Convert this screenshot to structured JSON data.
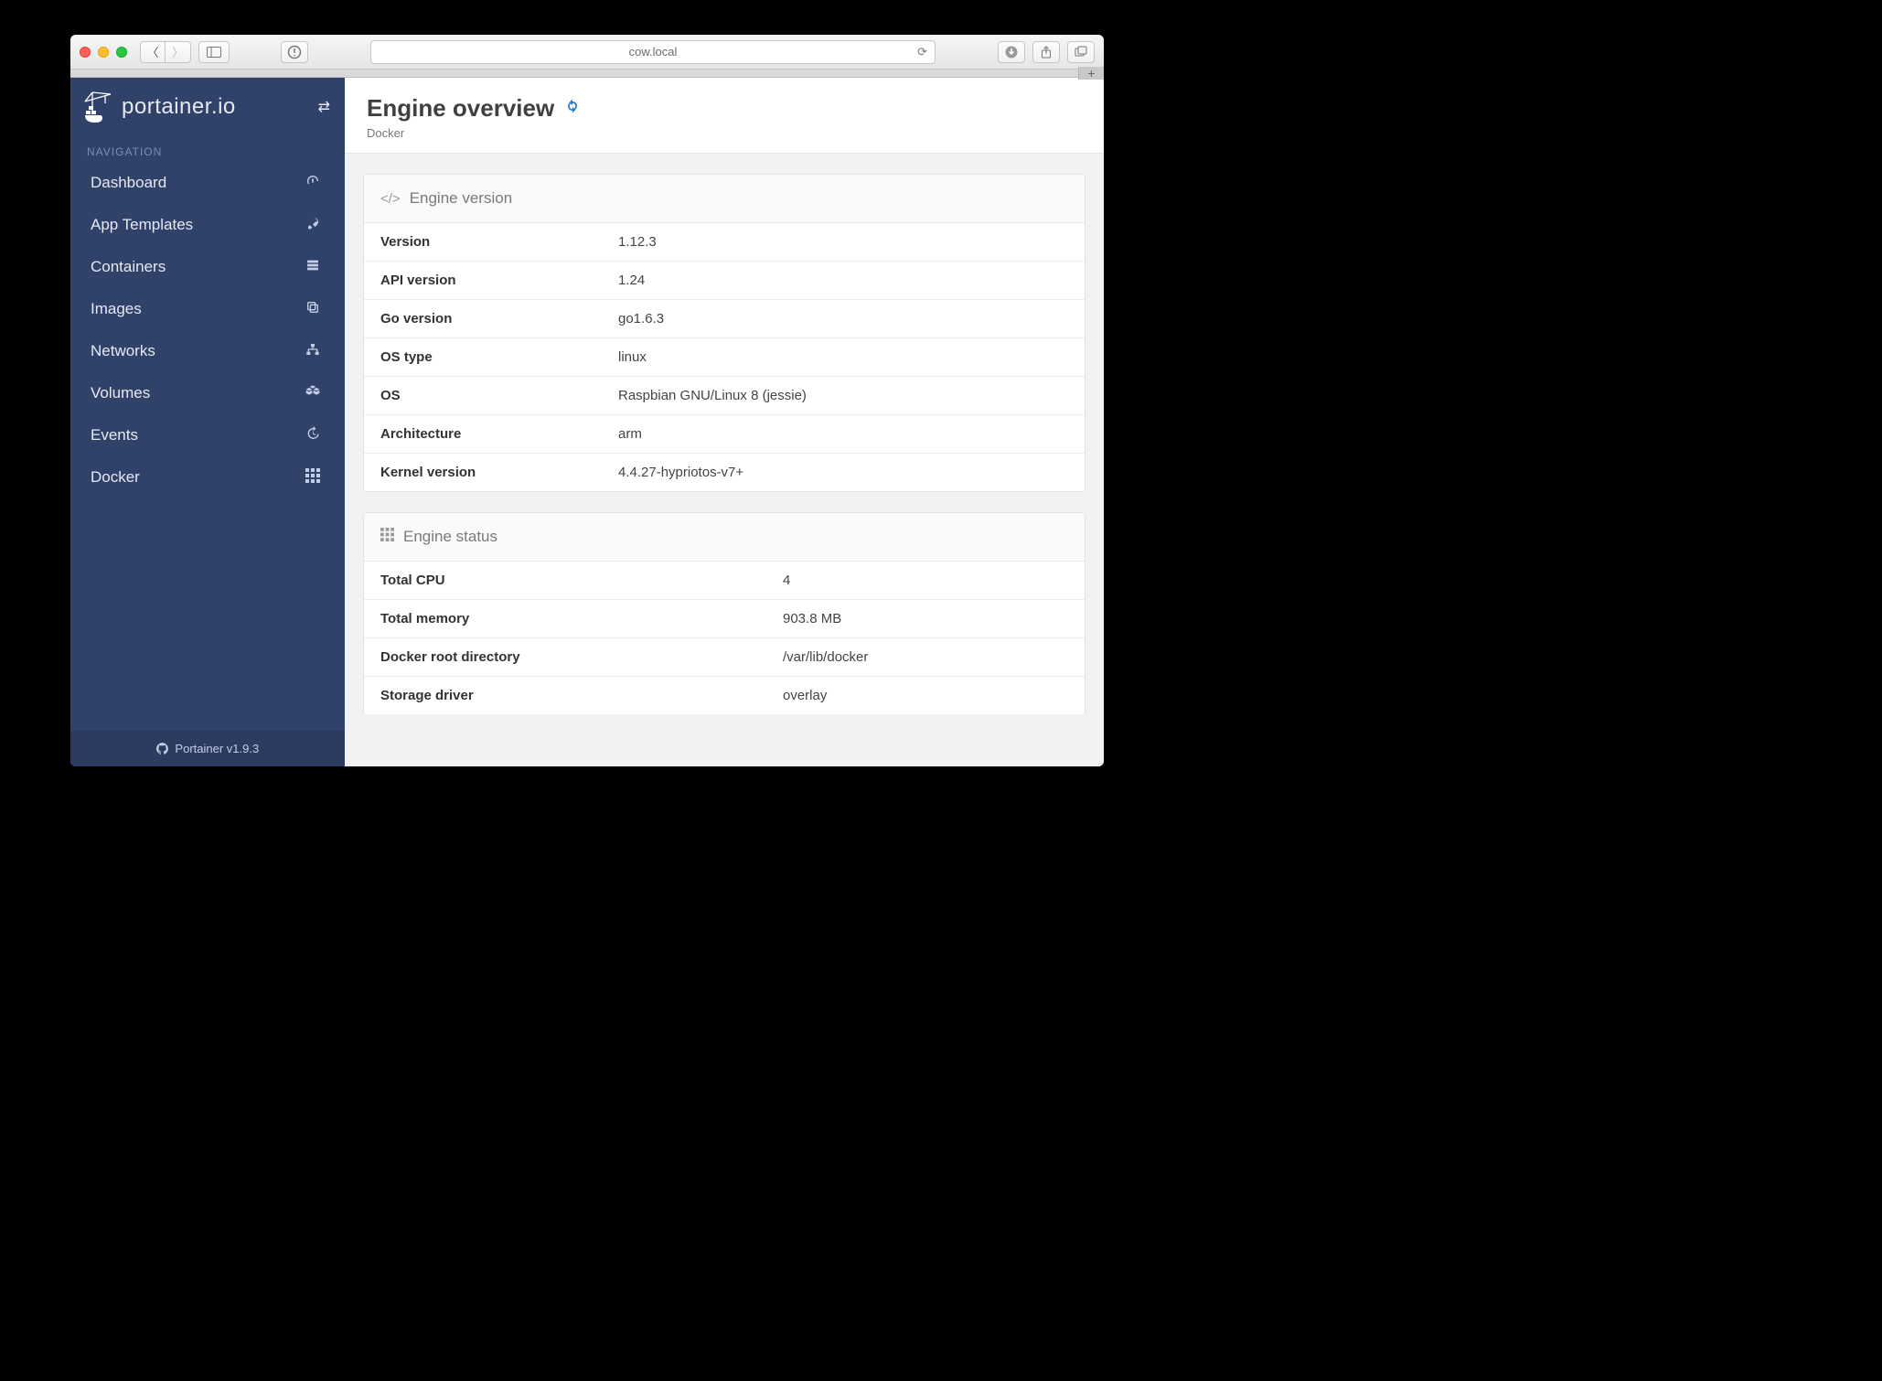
{
  "browser": {
    "url": "cow.local"
  },
  "brand": "portainer.io",
  "nav_heading": "NAVIGATION",
  "nav": [
    {
      "label": "Dashboard",
      "icon": "tachometer-icon"
    },
    {
      "label": "App Templates",
      "icon": "rocket-icon"
    },
    {
      "label": "Containers",
      "icon": "server-icon"
    },
    {
      "label": "Images",
      "icon": "clone-icon"
    },
    {
      "label": "Networks",
      "icon": "sitemap-icon"
    },
    {
      "label": "Volumes",
      "icon": "cubes-icon"
    },
    {
      "label": "Events",
      "icon": "history-icon"
    },
    {
      "label": "Docker",
      "icon": "th-icon"
    }
  ],
  "footer": "Portainer v1.9.3",
  "page": {
    "title": "Engine overview",
    "subtitle": "Docker"
  },
  "panels": {
    "engine_version": {
      "title": "Engine version",
      "rows": [
        {
          "k": "Version",
          "v": "1.12.3"
        },
        {
          "k": "API version",
          "v": "1.24"
        },
        {
          "k": "Go version",
          "v": "go1.6.3"
        },
        {
          "k": "OS type",
          "v": "linux"
        },
        {
          "k": "OS",
          "v": "Raspbian GNU/Linux 8 (jessie)"
        },
        {
          "k": "Architecture",
          "v": "arm"
        },
        {
          "k": "Kernel version",
          "v": "4.4.27-hypriotos-v7+"
        }
      ]
    },
    "engine_status": {
      "title": "Engine status",
      "rows": [
        {
          "k": "Total CPU",
          "v": "4"
        },
        {
          "k": "Total memory",
          "v": "903.8 MB"
        },
        {
          "k": "Docker root directory",
          "v": "/var/lib/docker"
        },
        {
          "k": "Storage driver",
          "v": "overlay"
        }
      ]
    }
  }
}
